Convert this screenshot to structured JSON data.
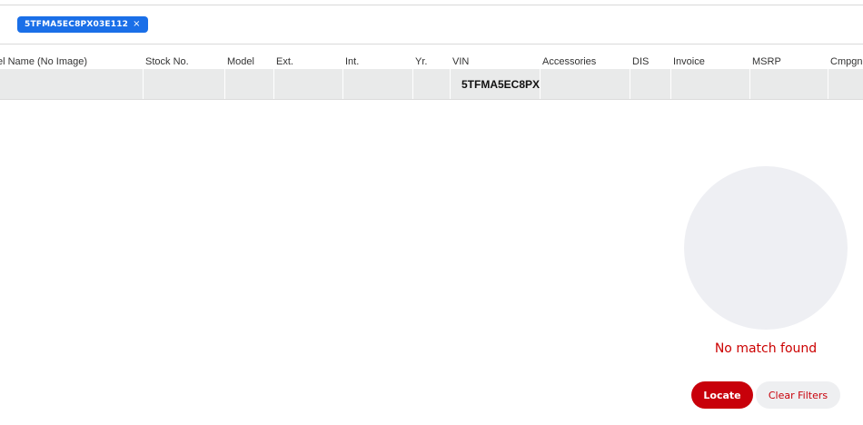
{
  "filters": {
    "chips": [
      {
        "label": "5TFMA5EC8PX03E112",
        "close_symbol": "×"
      }
    ]
  },
  "table": {
    "headers": [
      "el Name (No Image)",
      "Stock No.",
      "Model",
      "Ext.",
      "Int.",
      "Yr.",
      "VIN",
      "Accessories",
      "DIS",
      "Invoice",
      "MSRP",
      "Cmpgn"
    ],
    "rows": [
      {
        "vin": "5TFMA5EC8PX"
      }
    ]
  },
  "empty_state": {
    "message": "No match found"
  },
  "actions": {
    "locate_label": "Locate",
    "clear_label": "Clear Filters"
  },
  "colors": {
    "chip": "#1a6fe8",
    "accent_red": "#c8000a",
    "row_bg": "#e9eaea"
  }
}
